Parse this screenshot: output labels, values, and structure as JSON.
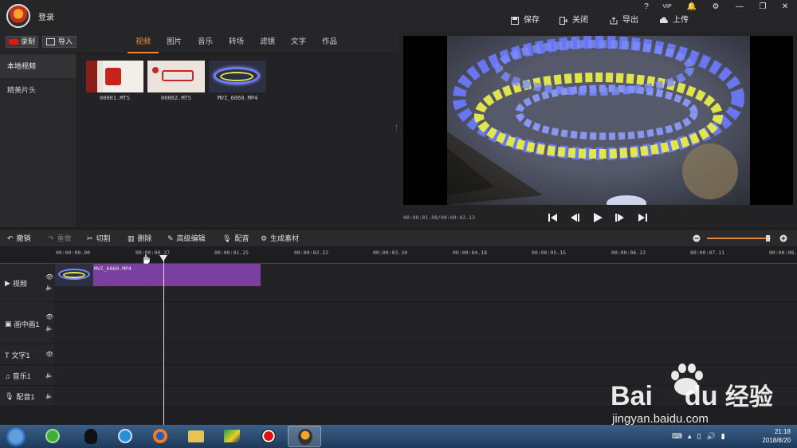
{
  "app": {
    "login_label": "登录",
    "window_controls": [
      "?",
      "VIP",
      "🔔",
      "⚙",
      "—",
      "❐",
      "✕"
    ],
    "actions": [
      {
        "label": "保存",
        "icon": "save-icon"
      },
      {
        "label": "关闭",
        "icon": "close-file-icon"
      },
      {
        "label": "导出",
        "icon": "export-icon"
      },
      {
        "label": "上传",
        "icon": "upload-icon"
      }
    ]
  },
  "library": {
    "record_label": "录制",
    "import_label": "导入",
    "tabs": [
      "视频",
      "图片",
      "音乐",
      "转场",
      "滤镜",
      "文字",
      "作品"
    ],
    "active_tab": "视频",
    "nav": [
      "本地视频",
      "精美片头"
    ],
    "active_nav": "本地视频",
    "items": [
      {
        "name": "00001.MTS"
      },
      {
        "name": "00002.MTS"
      },
      {
        "name": "MVI_6060.MP4"
      }
    ]
  },
  "preview": {
    "timecode": "00:00:01.08/00:00:02.13"
  },
  "timeline": {
    "toolbar": [
      {
        "label": "撤销",
        "icon": "undo-icon"
      },
      {
        "label": "重做",
        "icon": "redo-icon"
      },
      {
        "label": "切割",
        "icon": "scissors-icon"
      },
      {
        "label": "删除",
        "icon": "trash-icon"
      },
      {
        "label": "高级编辑",
        "icon": "pencil-icon"
      },
      {
        "label": "配音",
        "icon": "microphone-icon"
      },
      {
        "label": "生成素材",
        "icon": "film-reel-icon"
      }
    ],
    "ruler": [
      "00:00:00.00",
      "00:00:00.27",
      "00:00:01.25",
      "00:00:02.22",
      "00:00:03.20",
      "00:00:04.18",
      "00:00:05.15",
      "00:00:06.13",
      "00:00:07.11",
      "00:00:08.0"
    ],
    "tracks": [
      "视频",
      "画中画1",
      "文字1",
      "音乐1",
      "配音1"
    ],
    "clip_name": "MVI_6060.MP4",
    "zoom_level": 0.95
  },
  "taskbar": {
    "time": "21:18",
    "date": "2018/8/20"
  },
  "watermark": {
    "brand": "Bai",
    "brand2": "du",
    "cn": "经验",
    "url": "jingyan.baidu.com"
  },
  "colors": {
    "accent": "#f08a3a",
    "clip": "#7a3fa0",
    "record": "#e11111"
  }
}
